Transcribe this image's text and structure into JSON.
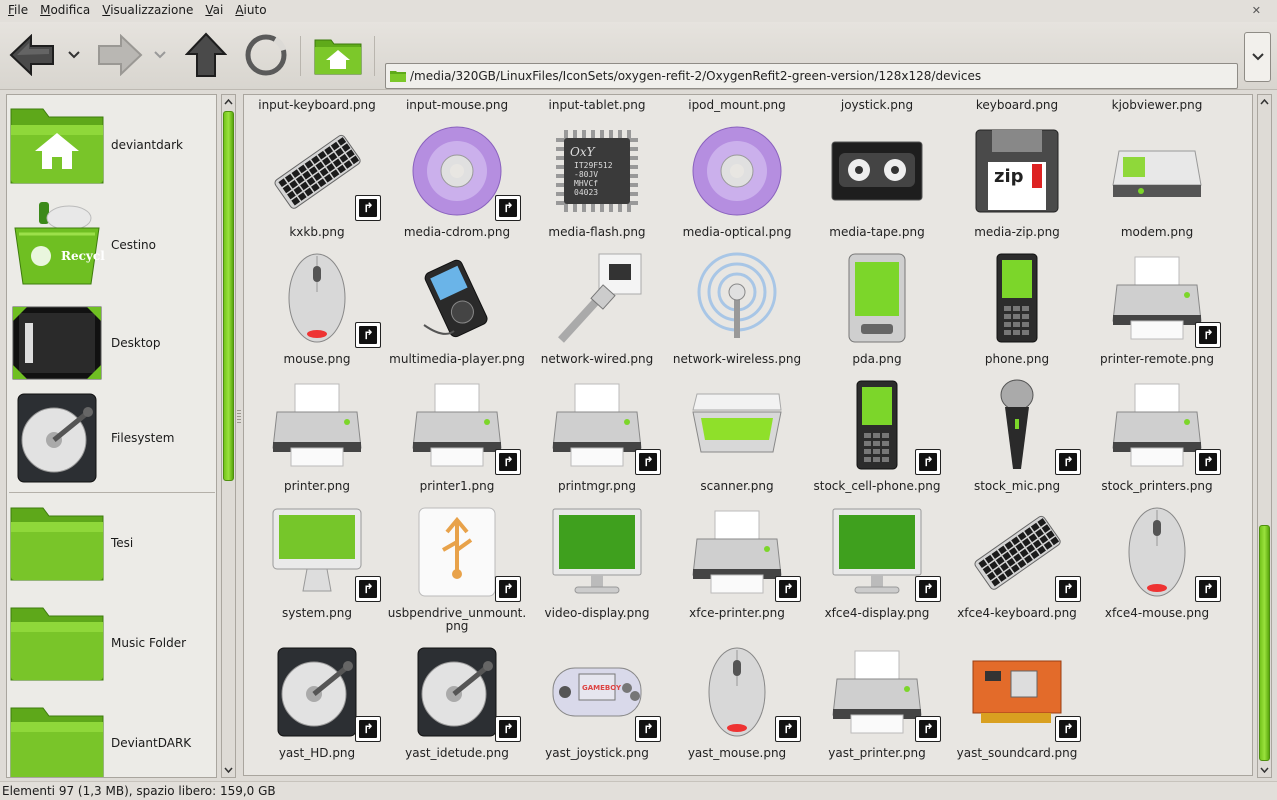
{
  "menu": [
    "File",
    "Modifica",
    "Visualizzazione",
    "Vai",
    "Aiuto"
  ],
  "location": {
    "path": "/media/320GB/LinuxFiles/IconSets/oxygen-refit-2/OxygenRefit2-green-version/128x128/devices"
  },
  "sidebar": {
    "places": [
      {
        "label": "deviantdark",
        "icon": "home-folder-icon"
      },
      {
        "label": "Cestino",
        "icon": "trash-icon"
      },
      {
        "label": "Desktop",
        "icon": "desktop-icon"
      },
      {
        "label": "Filesystem",
        "icon": "harddisk-icon"
      },
      {
        "label": "Tesi",
        "icon": "folder-icon"
      },
      {
        "label": "Music Folder",
        "icon": "folder-icon"
      },
      {
        "label": "DeviantDARK",
        "icon": "folder-icon"
      }
    ]
  },
  "files": {
    "top_row": [
      "input-keyboard.png",
      "input-mouse.png",
      "input-tablet.png",
      "ipod_mount.png",
      "joystick.png",
      "keyboard.png",
      "kjobviewer.png"
    ],
    "rows": [
      [
        {
          "name": "kxkb.png",
          "icon": "keyboard-icon",
          "link": true
        },
        {
          "name": "media-cdrom.png",
          "icon": "cdrom-icon",
          "link": true
        },
        {
          "name": "media-flash.png",
          "icon": "flash-chip-icon",
          "link": false,
          "chip_text": [
            "IT29F512",
            "-80JV",
            "MHVCf",
            "04023"
          ]
        },
        {
          "name": "media-optical.png",
          "icon": "optical-disc-icon",
          "link": false
        },
        {
          "name": "media-tape.png",
          "icon": "tape-icon",
          "link": false
        },
        {
          "name": "media-zip.png",
          "icon": "zip-disk-icon",
          "link": false,
          "label_text": "zip"
        },
        {
          "name": "modem.png",
          "icon": "modem-icon",
          "link": false
        }
      ],
      [
        {
          "name": "mouse.png",
          "icon": "mouse-icon",
          "link": true
        },
        {
          "name": "multimedia-player.png",
          "icon": "media-player-icon",
          "link": false
        },
        {
          "name": "network-wired.png",
          "icon": "network-wired-icon",
          "link": false
        },
        {
          "name": "network-wireless.png",
          "icon": "network-wireless-icon",
          "link": false
        },
        {
          "name": "pda.png",
          "icon": "pda-icon",
          "link": false
        },
        {
          "name": "phone.png",
          "icon": "phone-icon",
          "link": false
        },
        {
          "name": "printer-remote.png",
          "icon": "printer-icon",
          "link": true
        }
      ],
      [
        {
          "name": "printer.png",
          "icon": "printer-icon",
          "link": false
        },
        {
          "name": "printer1.png",
          "icon": "printer-icon",
          "link": true
        },
        {
          "name": "printmgr.png",
          "icon": "printer-icon",
          "link": true
        },
        {
          "name": "scanner.png",
          "icon": "scanner-icon",
          "link": false
        },
        {
          "name": "stock_cell-phone.png",
          "icon": "phone-icon",
          "link": true
        },
        {
          "name": "stock_mic.png",
          "icon": "microphone-icon",
          "link": true
        },
        {
          "name": "stock_printers.png",
          "icon": "printer-icon",
          "link": true
        }
      ],
      [
        {
          "name": "system.png",
          "icon": "imac-icon",
          "link": true
        },
        {
          "name": "usbpendrive_unmount.png",
          "icon": "usb-drive-icon",
          "link": true
        },
        {
          "name": "video-display.png",
          "icon": "monitor-icon",
          "link": false
        },
        {
          "name": "xfce-printer.png",
          "icon": "printer-icon",
          "link": true
        },
        {
          "name": "xfce4-display.png",
          "icon": "monitor-icon",
          "link": true
        },
        {
          "name": "xfce4-keyboard.png",
          "icon": "keyboard-icon",
          "link": true
        },
        {
          "name": "xfce4-mouse.png",
          "icon": "mouse-icon",
          "link": true
        }
      ],
      [
        {
          "name": "yast_HD.png",
          "icon": "harddisk-icon",
          "link": true
        },
        {
          "name": "yast_idetude.png",
          "icon": "harddisk-icon",
          "link": true
        },
        {
          "name": "yast_joystick.png",
          "icon": "gameboy-icon",
          "link": true,
          "label_text": "GAMEBOY"
        },
        {
          "name": "yast_mouse.png",
          "icon": "mouse-icon",
          "link": true
        },
        {
          "name": "yast_printer.png",
          "icon": "printer-icon",
          "link": true
        },
        {
          "name": "yast_soundcard.png",
          "icon": "soundcard-icon",
          "link": true
        }
      ]
    ]
  },
  "status": "Elementi 97 (1,3 MB), spazio libero: 159,0 GB",
  "colors": {
    "accent_green": "#6fbd1f",
    "window_bg": "#dedbd6"
  }
}
